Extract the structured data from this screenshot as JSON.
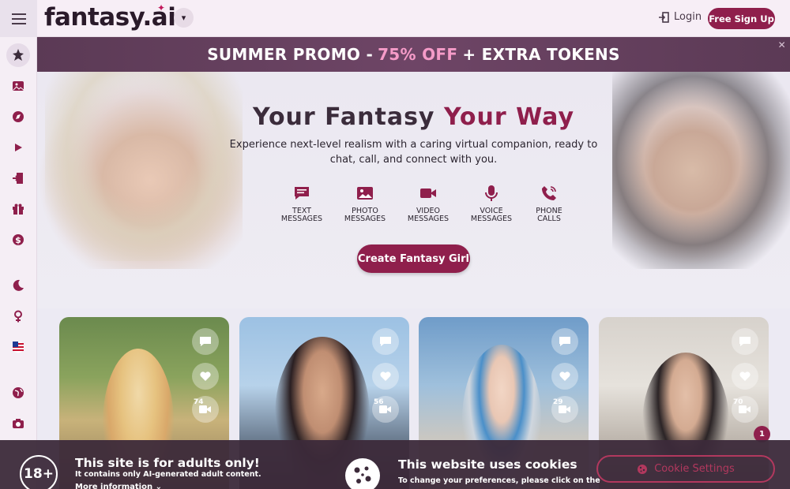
{
  "header": {
    "logo": "fantasy.ai",
    "login_label": "Login",
    "signup_label": "Free Sign Up"
  },
  "promo": {
    "part1": "SUMMER PROMO -",
    "accent": "75% OFF",
    "part2": "+ EXTRA TOKENS"
  },
  "hero": {
    "title_part1": "Your Fantasy",
    "title_accent": "Your Way",
    "subtitle": "Experience next-level realism with a caring virtual companion, ready to chat, call, and connect with you.",
    "features": [
      {
        "line1": "TEXT",
        "line2": "MESSAGES",
        "icon": "chat-icon"
      },
      {
        "line1": "PHOTO",
        "line2": "MESSAGES",
        "icon": "photo-icon"
      },
      {
        "line1": "VIDEO",
        "line2": "MESSAGES",
        "icon": "video-icon"
      },
      {
        "line1": "VOICE",
        "line2": "MESSAGES",
        "icon": "microphone-icon"
      },
      {
        "line1": "PHONE",
        "line2": "CALLS",
        "icon": "phone-icon"
      }
    ],
    "cta_label": "Create Fantasy Girl"
  },
  "sidebar": {
    "icons": [
      "sparkle-icon",
      "gallery-icon",
      "compass-icon",
      "play-icon",
      "door-icon",
      "gift-icon",
      "dollar-icon",
      "moon-icon",
      "female-icon",
      "us-flag-icon",
      "globe-icon",
      "camera-icon"
    ]
  },
  "cards": [
    {
      "video_count": "74"
    },
    {
      "video_count": "56"
    },
    {
      "video_count": "29"
    },
    {
      "video_count": "70"
    }
  ],
  "notification_badge": "1",
  "cookie_banner": {
    "age_badge": "18+",
    "adult_title": "This site is for adults only!",
    "adult_sub": "It contains only AI-generated adult content.",
    "adult_more": "More information",
    "cookie_title": "This website uses cookies",
    "cookie_sub": "To change your preferences, please click on the",
    "settings_label": "Cookie Settings"
  },
  "colors": {
    "brand": "#8f1f4c",
    "promo_accent": "#f59bc8",
    "banner_bg": "#3c2a3a"
  }
}
